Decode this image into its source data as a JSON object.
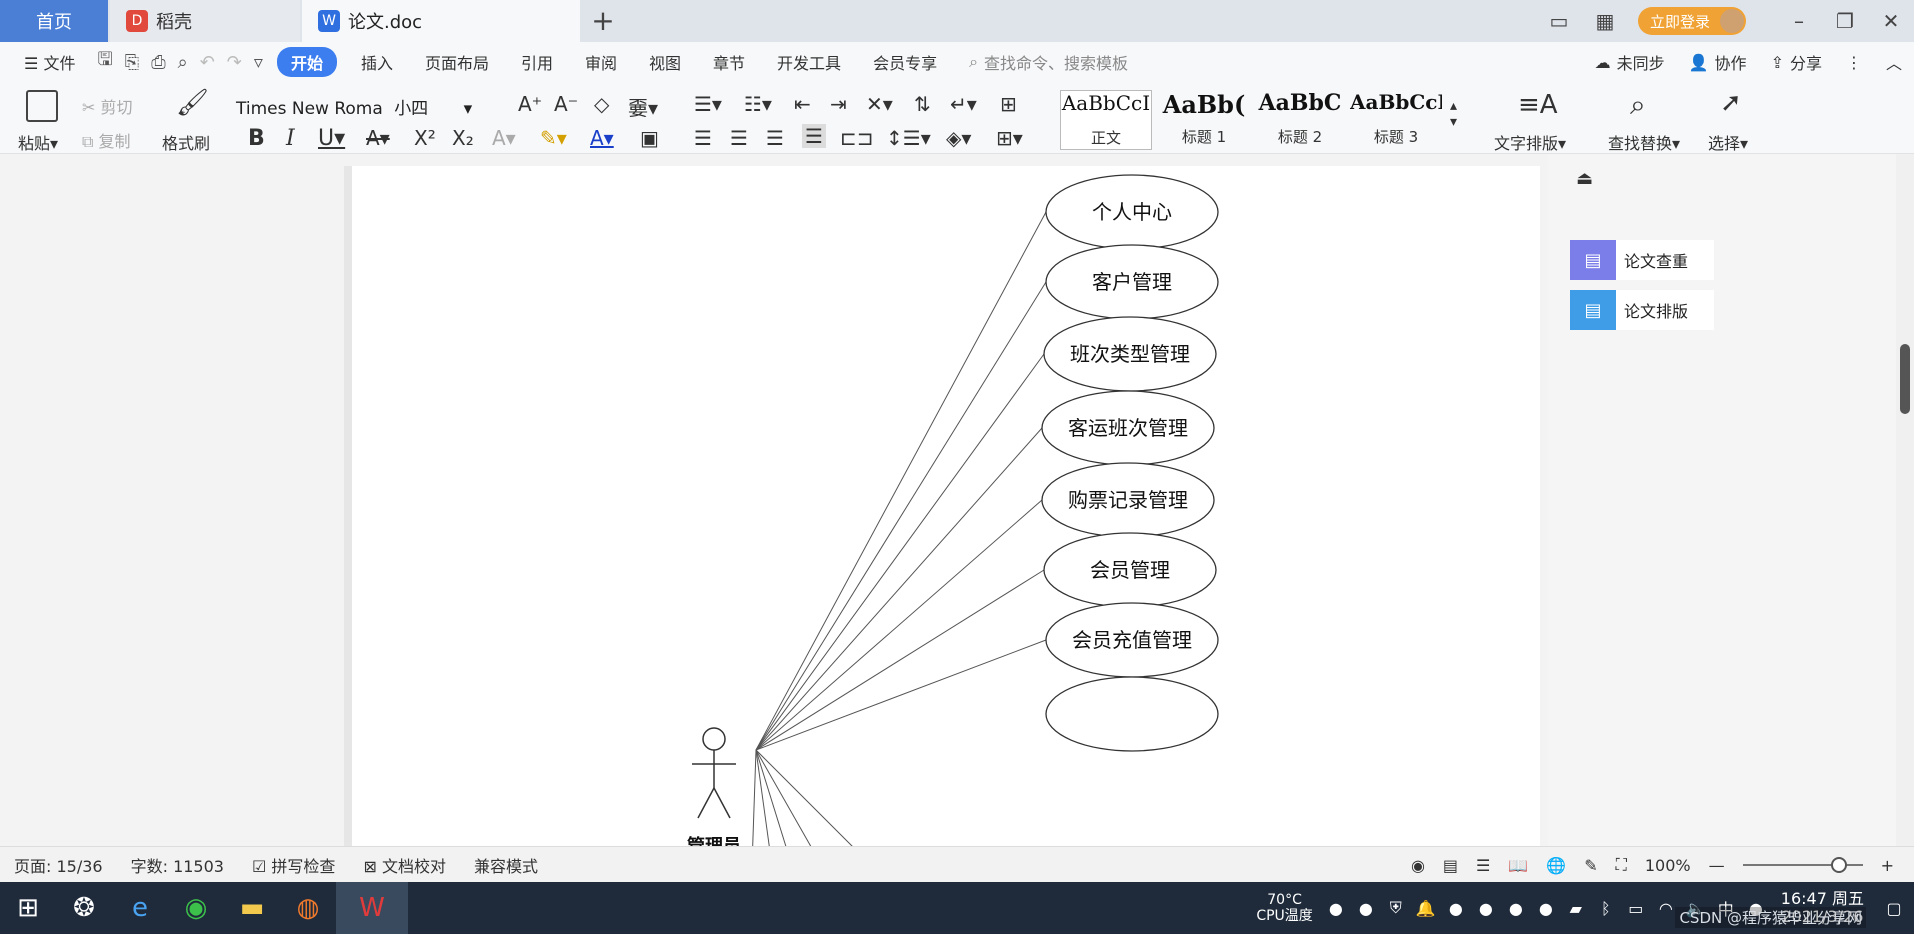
{
  "titlebar": {
    "tabs": [
      {
        "label": "首页",
        "kind": "home"
      },
      {
        "label": "稻壳",
        "kind": "docer"
      },
      {
        "label": "论文.doc",
        "kind": "active"
      }
    ],
    "new_tab": "+",
    "login": "立即登录"
  },
  "menubar": {
    "file": "文件",
    "items": [
      "开始",
      "插入",
      "页面布局",
      "引用",
      "审阅",
      "视图",
      "章节",
      "开发工具",
      "会员专享"
    ],
    "active_index": 0,
    "search_placeholder": "查找命令、搜索模板",
    "right": {
      "sync": "未同步",
      "collab": "协作",
      "share": "分享"
    }
  },
  "ribbon": {
    "paste": "粘贴",
    "cut": "剪切",
    "copy": "复制",
    "format_painter": "格式刷",
    "font_name": "Times New Roma",
    "font_size": "小四",
    "styles": [
      {
        "sample": "AaBbCcI",
        "label": "正文"
      },
      {
        "sample": "AaBb(",
        "label": "标题 1"
      },
      {
        "sample": "AaBbC",
        "label": "标题 2"
      },
      {
        "sample": "AaBbCcI",
        "label": "标题 3"
      }
    ],
    "text_layout": "文字排版",
    "find_replace": "查找替换",
    "select": "选择"
  },
  "diagram": {
    "actor_label": "管理员",
    "use_cases": [
      "个人中心",
      "客户管理",
      "班次类型管理",
      "客运班次管理",
      "购票记录管理",
      "会员管理",
      "会员充值管理"
    ]
  },
  "rightpanel": {
    "buttons": [
      "论文查重",
      "论文排版"
    ]
  },
  "statusbar": {
    "page": "页面: 15/36",
    "words": "字数: 11503",
    "spellcheck": "拼写检查",
    "proofread": "文档校对",
    "compat": "兼容模式",
    "zoom": "100%",
    "zoom_fraction": 0.8
  },
  "taskbar": {
    "cpu_temp": "70°C",
    "cpu_label": "CPU温度",
    "time": "16:47 周五",
    "date": "2021/3/26",
    "watermark": "CSDN @程序猿毕业分享网"
  }
}
